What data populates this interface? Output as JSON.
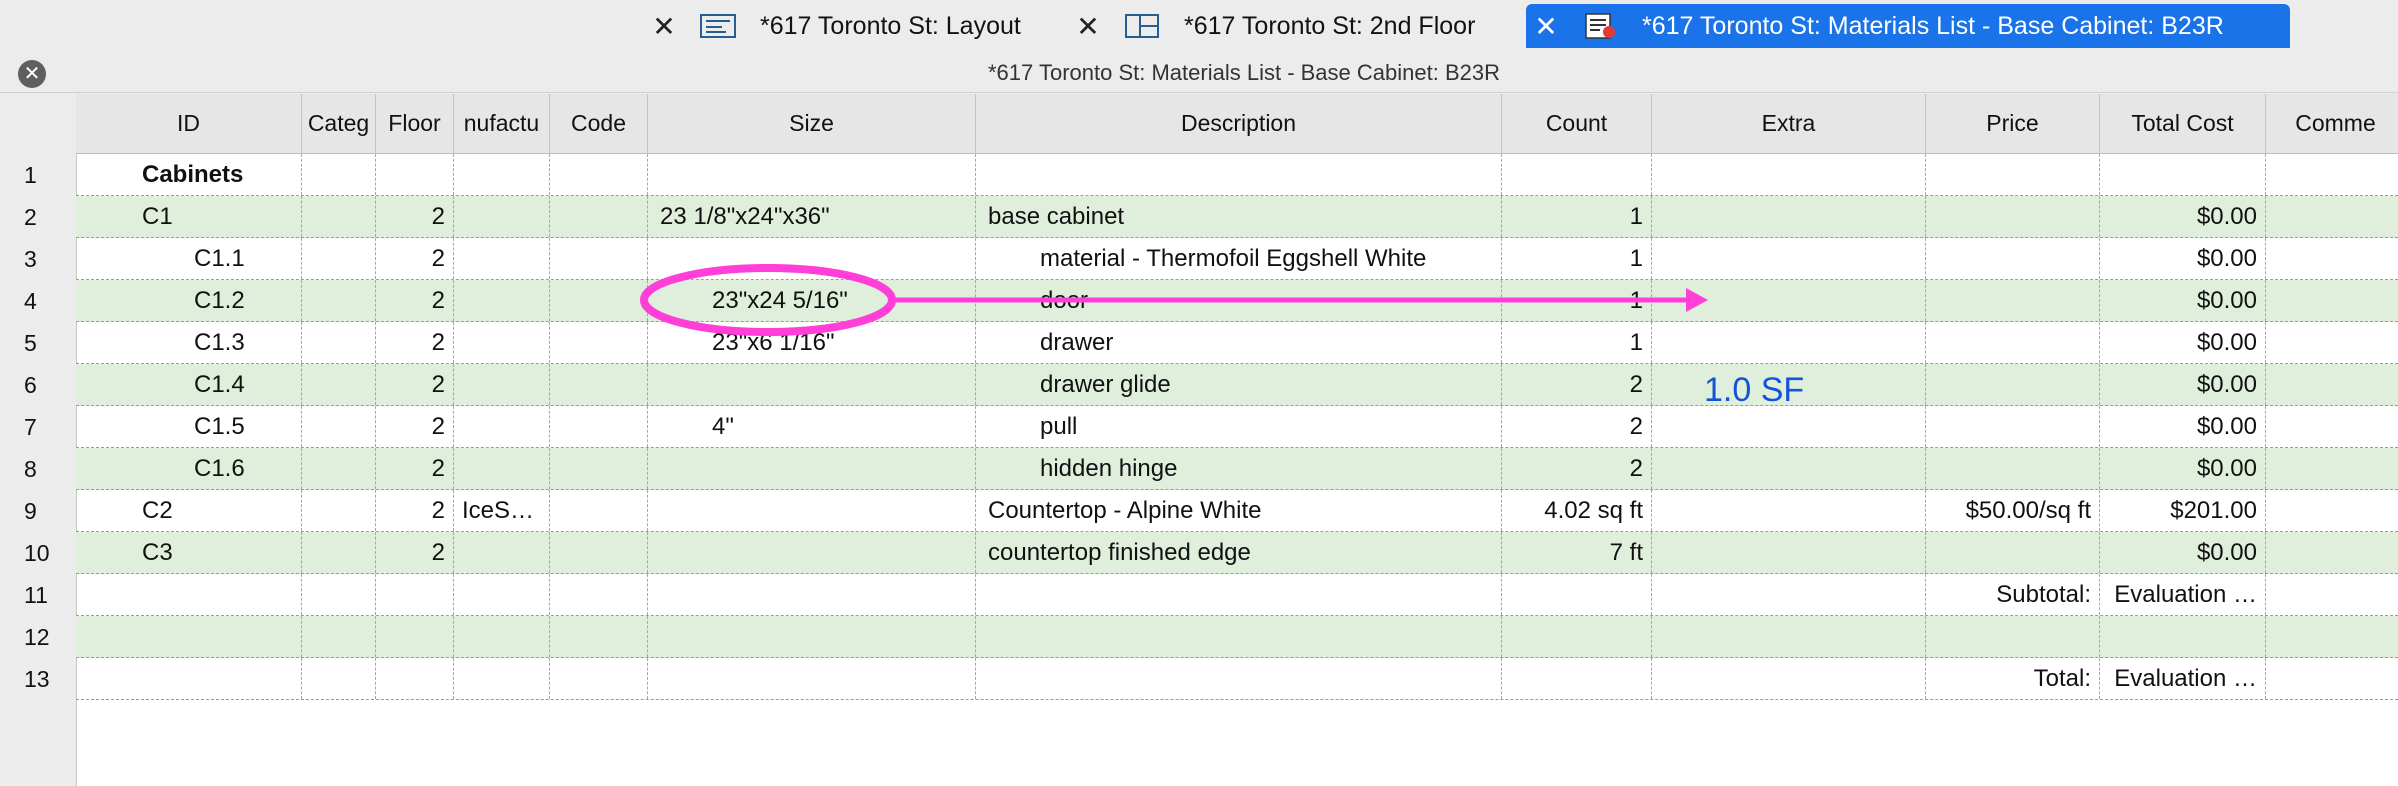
{
  "tabs": [
    {
      "label": "*617 Toronto St: Layout",
      "active": false
    },
    {
      "label": "*617 Toronto St: 2nd Floor",
      "active": false
    },
    {
      "label": "*617 Toronto St: Materials List - Base Cabinet: B23R",
      "active": true
    }
  ],
  "window_title": "*617 Toronto St: Materials List - Base Cabinet: B23R",
  "columns": [
    "ID",
    "Categ",
    "Floor",
    "nufactu",
    "Code",
    "Size",
    "Description",
    "Count",
    "Extra",
    "Price",
    "Total Cost",
    "Comme"
  ],
  "rows": [
    {
      "num": "1",
      "id": "Cabinets",
      "bold": true,
      "floor": "",
      "manu": "",
      "size": "",
      "desc": "",
      "count": "",
      "price": "",
      "total": ""
    },
    {
      "num": "2",
      "id": "C1",
      "floor": "2",
      "manu": "",
      "size": "23 1/8\"x24\"x36\"",
      "desc": "base cabinet",
      "count": "1",
      "price": "",
      "total": "$0.00"
    },
    {
      "num": "3",
      "id": "C1.1",
      "floor": "2",
      "manu": "",
      "size": "",
      "desc": "material - Thermofoil Eggshell White",
      "count": "1",
      "price": "",
      "total": "$0.00"
    },
    {
      "num": "4",
      "id": "C1.2",
      "floor": "2",
      "manu": "",
      "size": "23\"x24 5/16\"",
      "desc": "door",
      "count": "1",
      "price": "",
      "total": "$0.00"
    },
    {
      "num": "5",
      "id": "C1.3",
      "floor": "2",
      "manu": "",
      "size": "23\"x6 1/16\"",
      "desc": "drawer",
      "count": "1",
      "price": "",
      "total": "$0.00"
    },
    {
      "num": "6",
      "id": "C1.4",
      "floor": "2",
      "manu": "",
      "size": "",
      "desc": "drawer glide",
      "count": "2",
      "price": "",
      "total": "$0.00"
    },
    {
      "num": "7",
      "id": "C1.5",
      "floor": "2",
      "manu": "",
      "size": "4\"",
      "desc": "pull",
      "count": "2",
      "price": "",
      "total": "$0.00"
    },
    {
      "num": "8",
      "id": "C1.6",
      "floor": "2",
      "manu": "",
      "size": "",
      "desc": "hidden hinge",
      "count": "2",
      "price": "",
      "total": "$0.00"
    },
    {
      "num": "9",
      "id": "C2",
      "floor": "2",
      "manu": "IceS…",
      "size": "",
      "desc": "Countertop - Alpine White",
      "count": "4.02 sq ft",
      "price": "$50.00/sq ft",
      "total": "$201.00"
    },
    {
      "num": "10",
      "id": "C3",
      "floor": "2",
      "manu": "",
      "size": "",
      "desc": "countertop finished edge",
      "count": "7 ft",
      "price": "",
      "total": "$0.00"
    },
    {
      "num": "11",
      "id": "",
      "floor": "",
      "manu": "",
      "size": "",
      "desc": "",
      "count": "",
      "price": "Subtotal:",
      "total": "Evaluation …"
    },
    {
      "num": "12",
      "id": "",
      "floor": "",
      "manu": "",
      "size": "",
      "desc": "",
      "count": "",
      "price": "",
      "total": ""
    },
    {
      "num": "13",
      "id": "",
      "floor": "",
      "manu": "",
      "size": "",
      "desc": "",
      "count": "",
      "price": "Total:",
      "total": "Evaluation …"
    }
  ],
  "annotation": {
    "label": "1.0 SF",
    "color": "#ff3fd8",
    "text_color": "#1452d9"
  },
  "colors": {
    "active_tab": "#1a73e8",
    "row_alt": "#dfefdc"
  }
}
